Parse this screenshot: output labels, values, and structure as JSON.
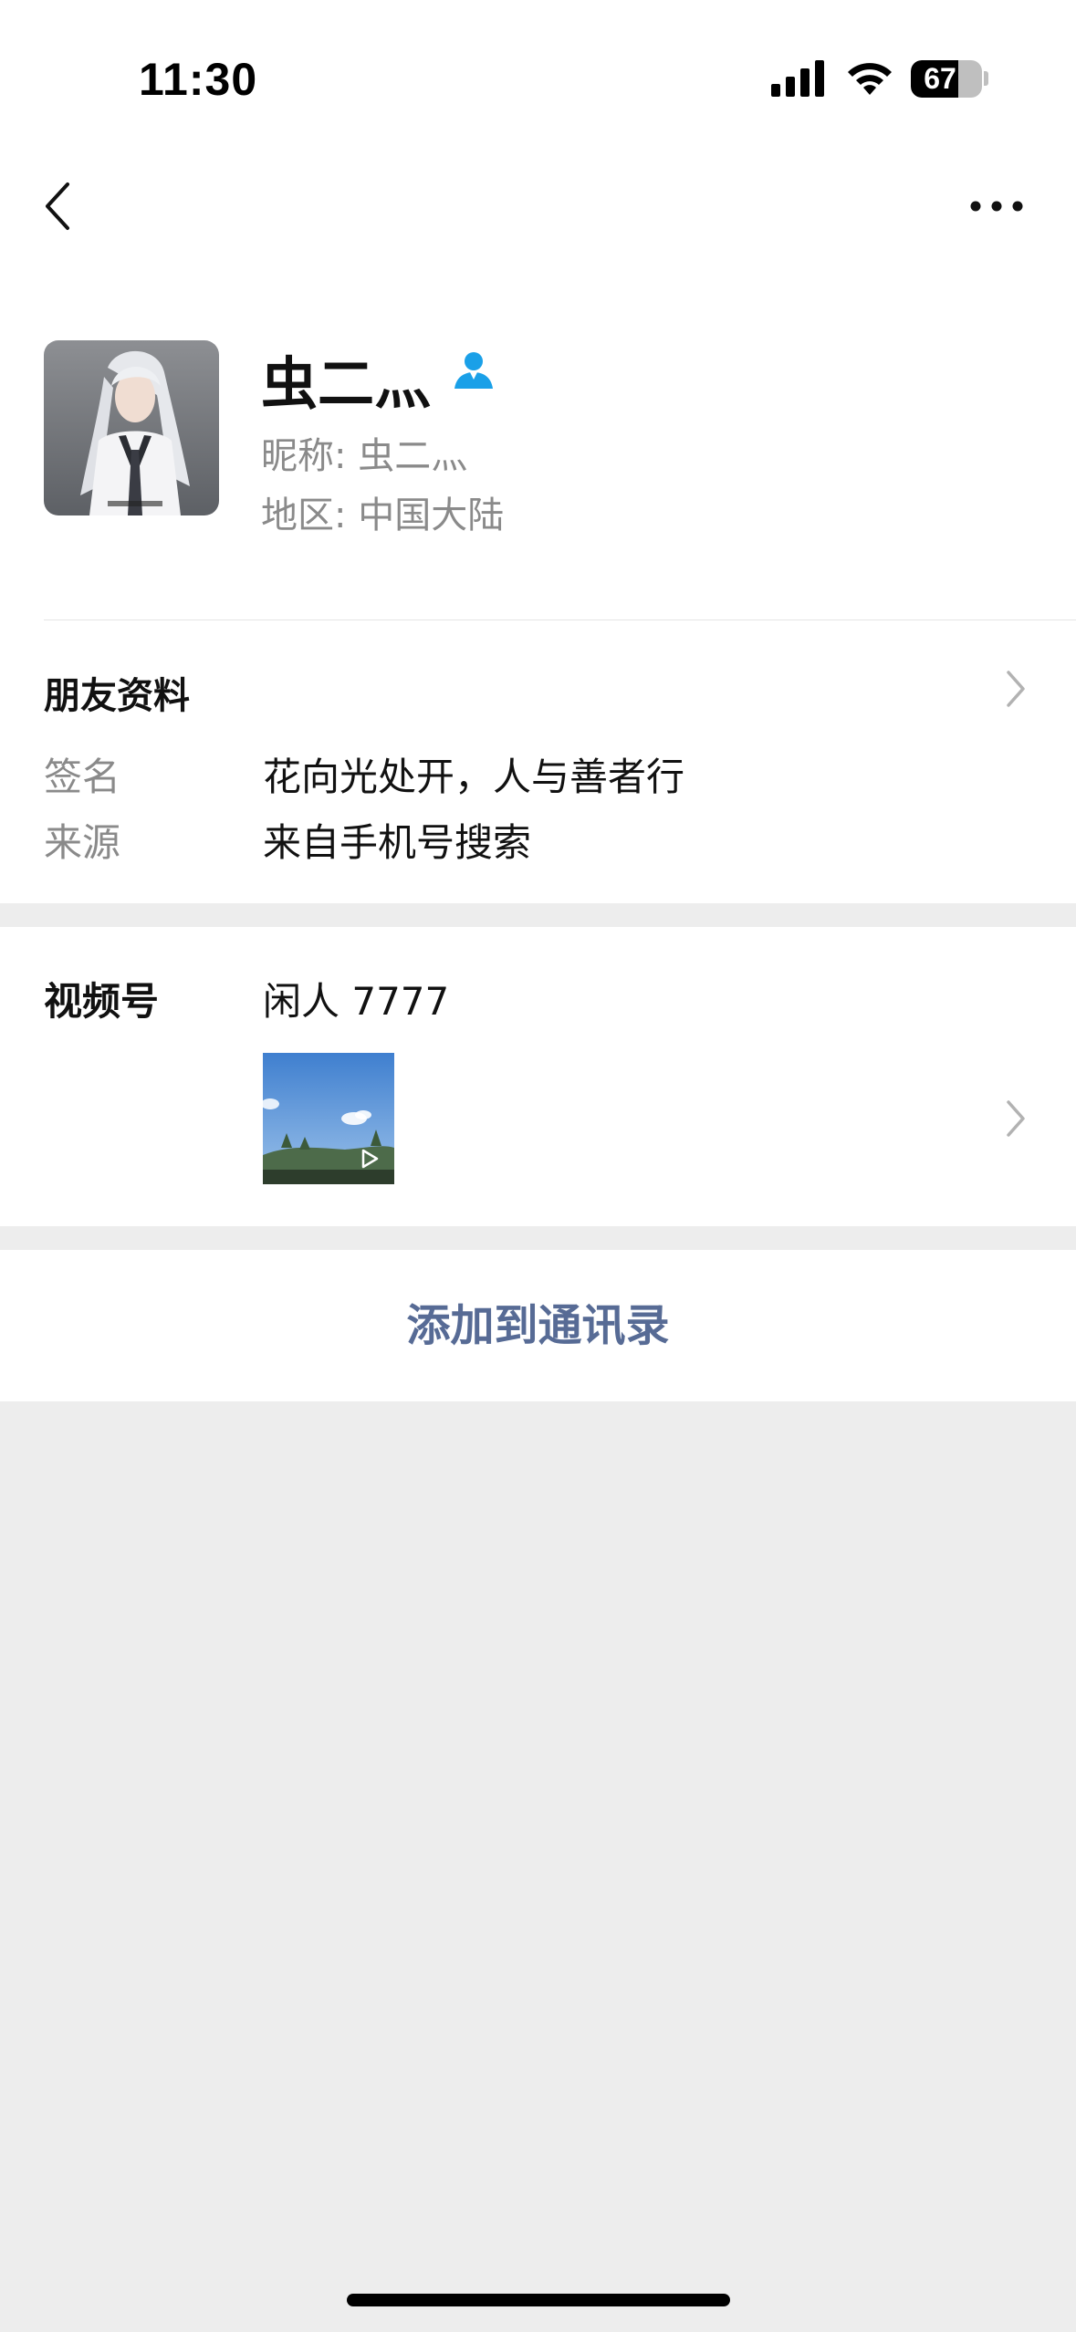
{
  "status_bar": {
    "time": "11:30",
    "battery_level": "67",
    "battery_fraction": 0.67
  },
  "nav": {
    "back_icon": "chevron-left-icon",
    "more_icon": "more-horizontal-icon"
  },
  "contact": {
    "name": "虫二灬",
    "nickname_line": "昵称: 虫二灬",
    "region_line": "地区: 中国大陆",
    "badge_icon": "person-icon",
    "badge_color": "#1aa0e8"
  },
  "profile": {
    "title": "朋友资料",
    "rows": [
      {
        "label": "签名",
        "value": "花向光处开，人与善者行"
      },
      {
        "label": "来源",
        "value": "来自手机号搜索"
      }
    ]
  },
  "channels": {
    "label": "视频号",
    "name": "闲人 7777",
    "thumb_icon": "play-icon"
  },
  "actions": {
    "add_to_contacts": "添加到通讯录",
    "link_color": "#576b95"
  }
}
